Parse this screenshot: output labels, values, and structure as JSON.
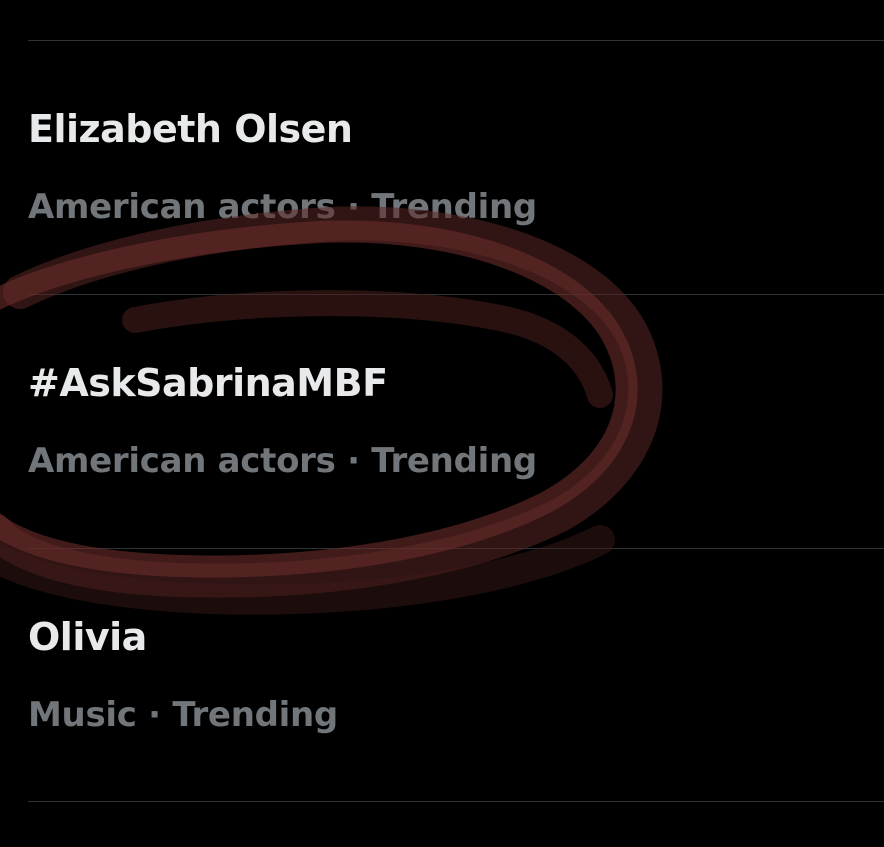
{
  "trends": [
    {
      "title": "Elizabeth Olsen",
      "category": "American actors",
      "separator": "·",
      "status": "Trending"
    },
    {
      "title": "#AskSabrinaMBF",
      "category": "American actors",
      "separator": "·",
      "status": "Trending"
    },
    {
      "title": "Olivia",
      "category": "Music",
      "separator": "·",
      "status": "Trending"
    }
  ],
  "colors": {
    "background": "#000000",
    "title": "#e7e9ea",
    "meta": "#71767b",
    "divider": "#2f3336",
    "annotation": "#8b3a36"
  }
}
